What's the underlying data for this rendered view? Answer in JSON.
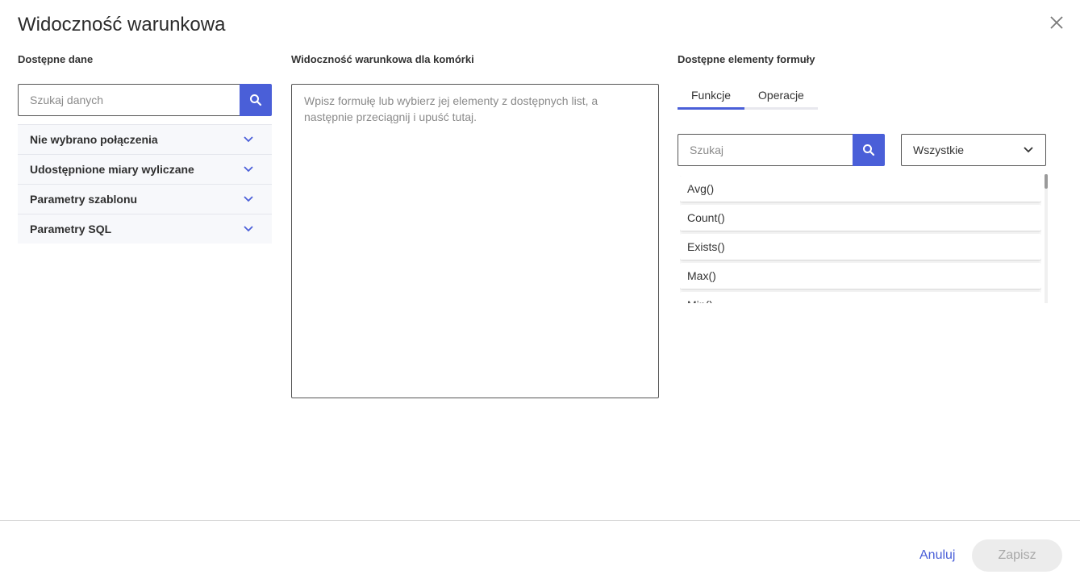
{
  "dialog": {
    "title": "Widoczność warunkowa",
    "close_icon": "close-icon"
  },
  "left": {
    "title": "Dostępne dane",
    "search_placeholder": "Szukaj danych",
    "sections": [
      {
        "label": "Nie wybrano połączenia"
      },
      {
        "label": "Udostępnione miary wyliczane"
      },
      {
        "label": "Parametry szablonu"
      },
      {
        "label": "Parametry SQL"
      }
    ]
  },
  "middle": {
    "title": "Widoczność warunkowa dla komórki",
    "formula_value": "",
    "formula_placeholder": "Wpisz formułę lub wybierz jej elementy z dostępnych list, a następnie przeciągnij i upuść tutaj."
  },
  "right": {
    "title": "Dostępne elementy formuły",
    "tabs": [
      {
        "label": "Funkcje",
        "active": true
      },
      {
        "label": "Operacje",
        "active": false
      }
    ],
    "search_placeholder": "Szukaj",
    "filter_selected": "Wszystkie",
    "functions": [
      "Avg()",
      "Count()",
      "Exists()",
      "Max()",
      "Min()"
    ]
  },
  "footer": {
    "cancel_label": "Anuluj",
    "save_label": "Zapisz"
  },
  "colors": {
    "accent": "#4a5fd8",
    "disabled_bg": "#ececec",
    "disabled_text": "#a8a8a8"
  }
}
